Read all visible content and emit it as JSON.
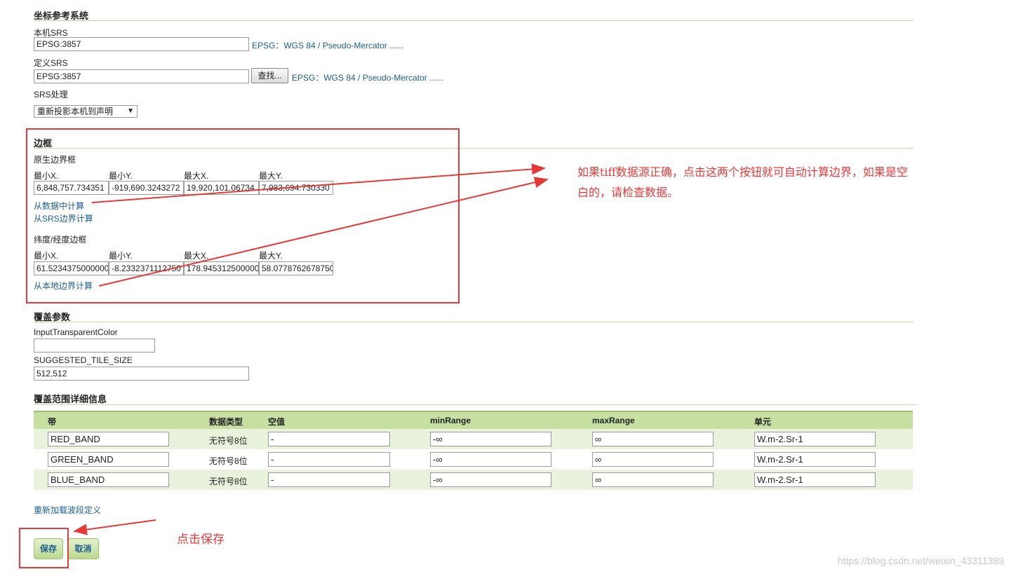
{
  "crs": {
    "title": "坐标参考系统",
    "native_label": "本机SRS",
    "native_value": "EPSG:3857",
    "native_link": "EPSG：WGS 84 / Pseudo-Mercator ......",
    "declared_label": "定义SRS",
    "declared_value": "EPSG:3857",
    "find_button": "查找...",
    "declared_link": "EPSG：WGS 84 / Pseudo-Mercator ......",
    "handling_label": "SRS处理",
    "handling_value": "重新投影本机到声明"
  },
  "bbox": {
    "title": "边框",
    "native_label": "原生边界框",
    "headers": [
      "最小X.",
      "最小Y.",
      "最大X.",
      "最大Y."
    ],
    "native_values": [
      "6,848,757.734351",
      "-919,690.3243272",
      "19,920,101.06734",
      "7,983,694.730330"
    ],
    "compute_from_data": "从数据中计算",
    "compute_from_srs": "从SRS边界计算",
    "latlon_label": "纬度/经度边框",
    "latlon_values": [
      "61.5234375000000",
      "-8.2332371112750",
      "178.945312500000",
      "58.0778762678750"
    ],
    "compute_from_native": "从本地边界计算"
  },
  "coverage": {
    "title": "覆盖参数",
    "transparent_label": "InputTransparentColor",
    "transparent_value": "",
    "tile_label": "SUGGESTED_TILE_SIZE",
    "tile_value": "512,512"
  },
  "bands": {
    "title": "覆盖范围详细信息",
    "headers": [
      "带",
      "数据类型",
      "空值",
      "minRange",
      "maxRange",
      "单元"
    ],
    "rows": [
      {
        "name": "RED_BAND",
        "type": "无符号8位",
        "nodata": "-",
        "min": "-∞",
        "max": "∞",
        "unit": "W.m-2.Sr-1"
      },
      {
        "name": "GREEN_BAND",
        "type": "无符号8位",
        "nodata": "-",
        "min": "-∞",
        "max": "∞",
        "unit": "W.m-2.Sr-1"
      },
      {
        "name": "BLUE_BAND",
        "type": "无符号8位",
        "nodata": "-",
        "min": "-∞",
        "max": "∞",
        "unit": "W.m-2.Sr-1"
      }
    ],
    "reload_link": "重新加载波段定义"
  },
  "actions": {
    "save": "保存",
    "cancel": "取消"
  },
  "annotations": {
    "bbox_note_line1": "如果tiff数据源正确，点击这两个按钮就可自动计算边界，如果是空",
    "bbox_note_line2": "白的，请检查数据。",
    "save_note": "点击保存"
  },
  "watermark": "https://blog.csdn.net/weixin_43311389",
  "colors": {
    "accent_red": "#e53a3a",
    "header_green": "#c8dfa2",
    "link_blue": "#1b5e8f"
  }
}
